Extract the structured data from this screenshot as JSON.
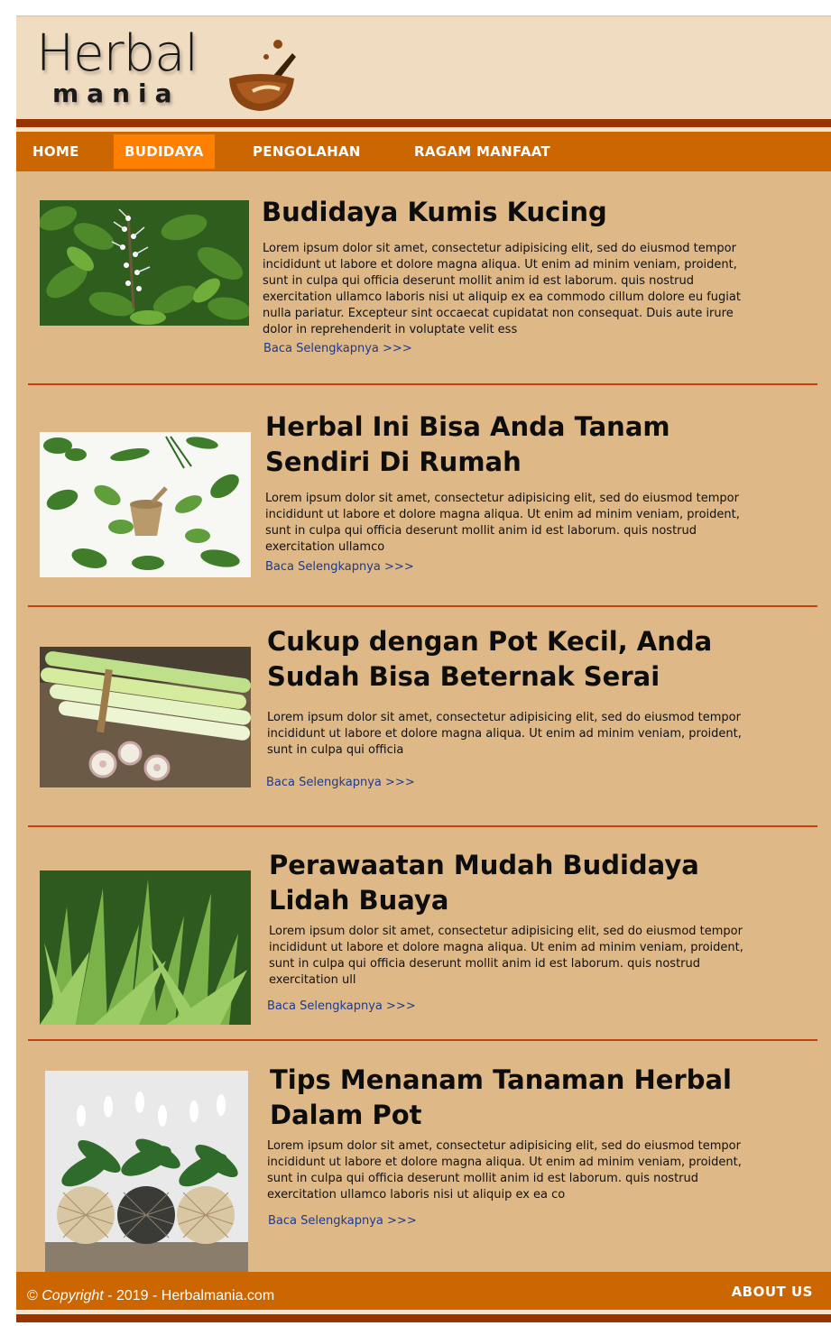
{
  "logo": {
    "line1": "Herbal",
    "line2": "mania"
  },
  "nav": {
    "items": [
      {
        "label": "HOME"
      },
      {
        "label": "BUDIDAYA"
      },
      {
        "label": "PENGOLAHAN"
      },
      {
        "label": "RAGAM MANFAAT"
      }
    ],
    "active": "BUDIDAYA"
  },
  "articles": [
    {
      "title": "Budidaya Kumis Kucing",
      "body": "Lorem ipsum dolor sit amet, consectetur adipisicing elit, sed do eiusmod tempor incididunt ut labore et dolore magna aliqua. Ut enim ad minim veniam, proident, sunt in culpa qui officia deserunt mollit anim id est laborum. quis nostrud exercitation ullamco laboris nisi ut aliquip ex ea commodo cillum dolore eu fugiat nulla pariatur. Excepteur sint occaecat cupidatat non consequat. Duis aute irure dolor in reprehenderit in voluptate velit ess",
      "read_more": "Baca Selengkapnya >>>",
      "image": "kumis-kucing-plant"
    },
    {
      "title": "Herbal Ini Bisa Anda Tanam Sendiri Di Rumah",
      "body": "Lorem ipsum dolor sit amet, consectetur adipisicing elit, sed do eiusmod tempor incididunt ut labore et dolore magna aliqua. Ut enim ad minim veniam, proident, sunt in culpa qui officia deserunt mollit anim id est laborum. quis nostrud exercitation ullamco",
      "read_more": "Baca Selengkapnya >>>",
      "image": "herbs-and-mortar"
    },
    {
      "title": "Cukup dengan Pot Kecil, Anda Sudah Bisa Beternak Serai",
      "body": "Lorem ipsum dolor sit amet, consectetur adipisicing elit, sed do eiusmod tempor incididunt ut labore et dolore magna aliqua. Ut enim ad minim veniam, proident, sunt in culpa qui officia",
      "read_more": "Baca Selengkapnya >>>",
      "image": "lemongrass-stalks"
    },
    {
      "title": "Perawaatan Mudah Budidaya Lidah Buaya",
      "body": "Lorem ipsum dolor sit amet, consectetur adipisicing elit, sed do eiusmod tempor incididunt ut labore et dolore magna aliqua. Ut enim ad minim veniam, proident, sunt in culpa qui officia deserunt mollit anim id est laborum. quis nostrud exercitation ull",
      "read_more": "Baca Selengkapnya >>>",
      "image": "aloe-vera-plants"
    },
    {
      "title": "Tips Menanam Tanaman Herbal Dalam Pot",
      "body": "Lorem ipsum dolor sit amet, consectetur adipisicing elit, sed do eiusmod tempor incididunt ut labore et dolore magna aliqua. Ut enim ad minim veniam, proident, sunt in culpa qui officia deserunt mollit anim id est laborum. quis nostrud exercitation ullamco laboris nisi ut aliquip ex ea co",
      "read_more": "Baca Selengkapnya >>>",
      "image": "potted-peace-lilies"
    }
  ],
  "footer": {
    "copyright_symbol": "©",
    "copyright_word": "Copyright",
    "copyright_rest": " - 2019 - Herbalmania.com",
    "about": "ABOUT US"
  },
  "colors": {
    "header_bg": "#f0dcc1",
    "dark_brown": "#993300",
    "nav_bg": "#cc6600",
    "nav_active": "#ff7f00",
    "content_bg": "#deb887",
    "divider": "#c2410c",
    "link": "#1f3a8a"
  }
}
